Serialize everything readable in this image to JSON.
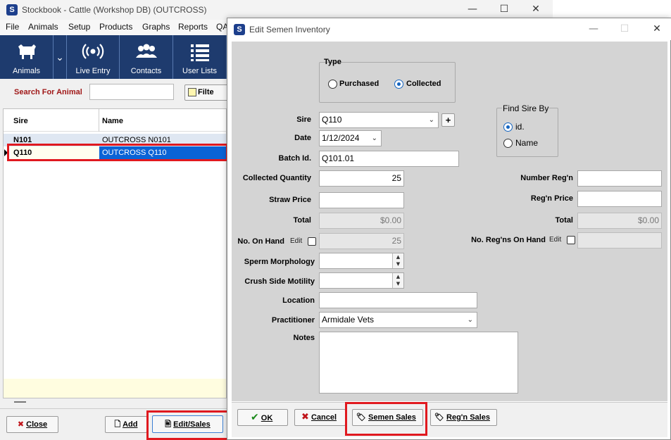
{
  "main_window": {
    "title": "Stockbook - Cattle (Workshop DB) (OUTCROSS)",
    "controls": {
      "minimize": "—",
      "maximize": "☐",
      "close": "✕"
    },
    "menu": [
      "File",
      "Animals",
      "Setup",
      "Products",
      "Graphs",
      "Reports",
      "QA"
    ],
    "toolbar": [
      {
        "label": "Animals",
        "icon": "cow-icon"
      },
      {
        "label": "Live Entry",
        "icon": "broadcast-icon"
      },
      {
        "label": "Contacts",
        "icon": "people-icon"
      },
      {
        "label": "User Lists",
        "icon": "list-icon"
      }
    ],
    "search": {
      "label": "Search For Animal",
      "value": "",
      "filter_label": "Filte"
    },
    "grid": {
      "columns": [
        "Sire",
        "Name"
      ],
      "rows": [
        {
          "sire": "N101",
          "name": "OUTCROSS N0101",
          "selected": false
        },
        {
          "sire": "Q110",
          "name": "OUTCROSS Q110",
          "selected": true
        }
      ]
    },
    "bottom_buttons": {
      "close": "Close",
      "add": "Add",
      "edit_sales": "Edit/Sales"
    }
  },
  "dialog": {
    "title": "Edit Semen Inventory",
    "type_group": {
      "title": "Type",
      "options": [
        {
          "label": "Purchased",
          "selected": false
        },
        {
          "label": "Collected",
          "selected": true
        }
      ]
    },
    "find_sire_by": {
      "title": "Find Sire By",
      "options": [
        {
          "label": "id.",
          "selected": true
        },
        {
          "label": "Name",
          "selected": false
        }
      ]
    },
    "fields": {
      "sire": {
        "label": "Sire",
        "value": "Q110",
        "add_label": "+"
      },
      "date": {
        "label": "Date",
        "value": "1/12/2024"
      },
      "batch_id": {
        "label": "Batch Id.",
        "value": "Q101.01"
      },
      "collected_quantity": {
        "label": "Collected Quantity",
        "value": "25"
      },
      "straw_price": {
        "label": "Straw Price",
        "value": ""
      },
      "total": {
        "label": "Total",
        "value": "$0.00"
      },
      "no_on_hand": {
        "label": "No. On Hand",
        "edit_label": "Edit",
        "value": "25"
      },
      "sperm_morphology": {
        "label": "Sperm Morphology",
        "value": ""
      },
      "crush_side_motility": {
        "label": "Crush Side Motility",
        "value": ""
      },
      "location": {
        "label": "Location",
        "value": ""
      },
      "practitioner": {
        "label": "Practitioner",
        "value": "Armidale Vets"
      },
      "notes": {
        "label": "Notes",
        "value": ""
      },
      "number_regn": {
        "label": "Number Reg'n",
        "value": ""
      },
      "regn_price": {
        "label": "Reg'n Price",
        "value": ""
      },
      "regn_total": {
        "label": "Total",
        "value": "$0.00"
      },
      "no_regns_on_hand": {
        "label": "No. Reg'ns On Hand",
        "edit_label": "Edit",
        "value": ""
      }
    },
    "buttons": {
      "ok": "OK",
      "cancel": "Cancel",
      "semen_sales": "Semen Sales",
      "regn_sales": "Reg'n Sales"
    },
    "controls": {
      "minimize": "—",
      "maximize": "☐",
      "close": "✕"
    }
  },
  "colors": {
    "toolbar_bg": "#1e3b6e",
    "selection_blue": "#0a63d6",
    "highlight_red": "#e0191f",
    "search_label_red": "#a01818",
    "dialog_body_gray": "#d4d4d4"
  }
}
